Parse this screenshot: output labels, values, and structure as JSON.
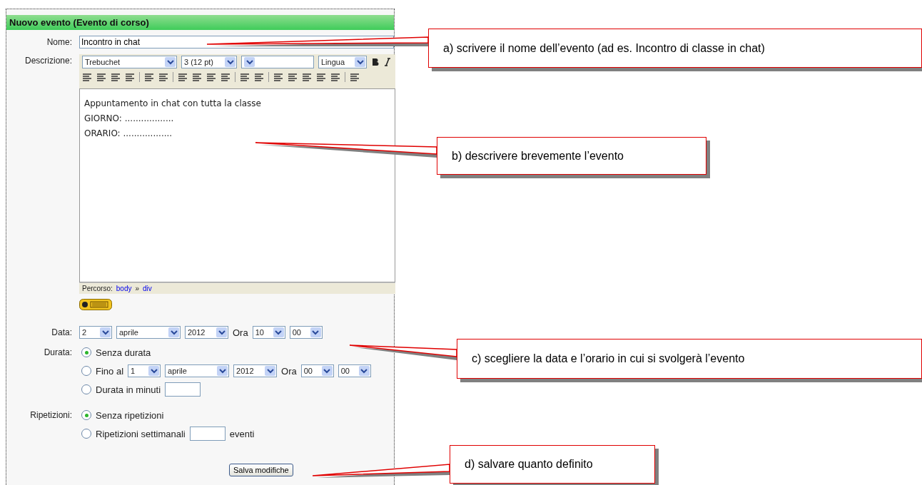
{
  "panel": {
    "title": "Nuovo evento (Evento di corso)"
  },
  "name_field": {
    "label": "Nome:",
    "value": "Incontro in chat"
  },
  "description": {
    "label": "Descrizione:",
    "font": "Trebuchet",
    "size": "3 (12 pt)",
    "language": "Lingua",
    "text_lines": [
      "Appuntamento in chat con tutta la classe",
      "GIORNO: ..................",
      "ORARIO: .................."
    ],
    "path_label": "Percorso:",
    "path_links": [
      "body",
      "div"
    ],
    "path_separator": "»"
  },
  "date": {
    "label": "Data:",
    "day": "2",
    "month": "aprile",
    "year": "2012",
    "time_label": "Ora",
    "hour": "10",
    "minute": "00"
  },
  "duration": {
    "label": "Durata:",
    "options": [
      {
        "kind": "plain",
        "label": "Senza durata",
        "selected": true
      },
      {
        "kind": "until",
        "label": "Fino al",
        "selected": false,
        "day": "1",
        "month": "aprile",
        "year": "2012",
        "time_label": "Ora",
        "hour": "00",
        "minute": "00"
      },
      {
        "kind": "minutes",
        "label": "Durata in minuti",
        "selected": false
      }
    ]
  },
  "repeat": {
    "label": "Ripetizioni:",
    "options": [
      {
        "kind": "plain",
        "label": "Senza ripetizioni",
        "selected": true
      },
      {
        "kind": "weekly",
        "label": "Ripetizioni settimanali",
        "suffix": "eventi",
        "selected": false
      }
    ]
  },
  "save_button": "Salva modifiche",
  "callouts": [
    {
      "text": "a) scrivere il nome dell’evento (ad es. Incontro di classe in chat)"
    },
    {
      "text": "b) descrivere brevemente l’evento"
    },
    {
      "text": "c) scegliere la data e l’orario in cui si svolgerà l’evento"
    },
    {
      "text": "d) salvare quanto definito"
    }
  ]
}
